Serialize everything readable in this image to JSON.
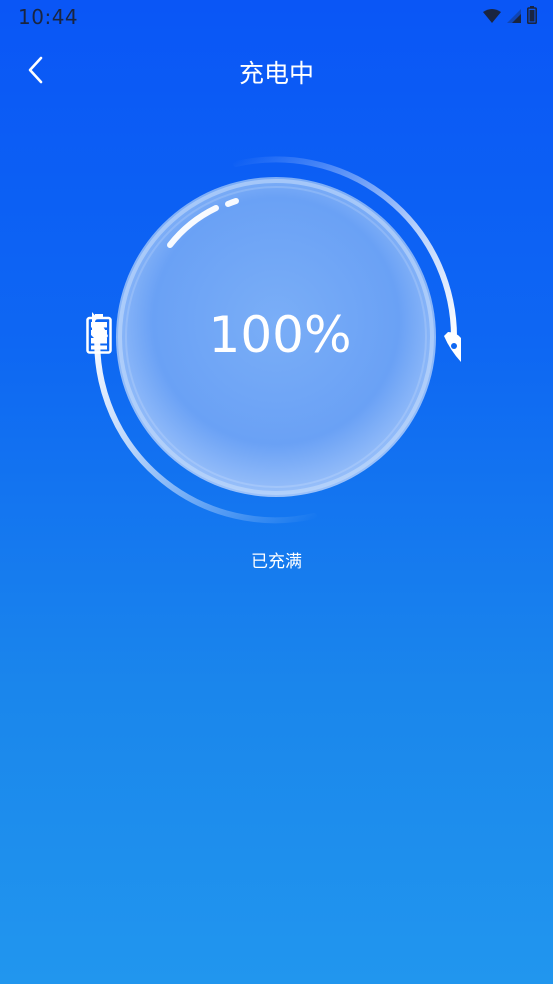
{
  "status_bar": {
    "time": "10:44",
    "icons": [
      "wifi-icon",
      "signal-icon",
      "battery-icon"
    ]
  },
  "app_bar": {
    "back_icon": "chevron-left-icon",
    "title": "充电中"
  },
  "charge": {
    "percent_text": "100%",
    "level": 1.0,
    "status_text": "已充满"
  },
  "colors": {
    "background_top": "#0a56f6",
    "background_bottom": "#2196ee",
    "bubble": "#6aa3f5",
    "text": "#ffffff",
    "status_time": "#1a2540"
  }
}
